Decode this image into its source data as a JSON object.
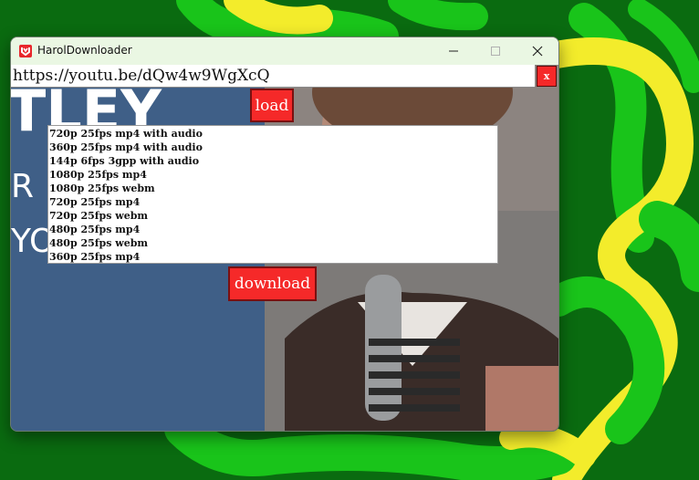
{
  "window": {
    "title": "HarolDownloader"
  },
  "url_input": {
    "value": "https://youtu.be/dQw4w9WgXcQ"
  },
  "buttons": {
    "clear_label": "x",
    "load_label": "load",
    "download_label": "download"
  },
  "formats": [
    "720p 25fps mp4 with audio",
    "360p 25fps mp4 with audio",
    "144p 6fps 3gpp with audio",
    "1080p 25fps mp4",
    "1080p 25fps webm",
    "720p 25fps mp4",
    "720p 25fps webm",
    "480p 25fps mp4",
    "480p 25fps webm",
    "360p 25fps mp4"
  ],
  "colors": {
    "button_red": "#f52929",
    "titlebar": "#eaf7e3",
    "desktop_green": "#0a6b10",
    "accent_yellow": "#f3ec2b"
  },
  "icons": {
    "app": "downloader-app-icon",
    "minimize": "minimize-icon",
    "maximize": "maximize-icon",
    "close": "close-icon"
  }
}
